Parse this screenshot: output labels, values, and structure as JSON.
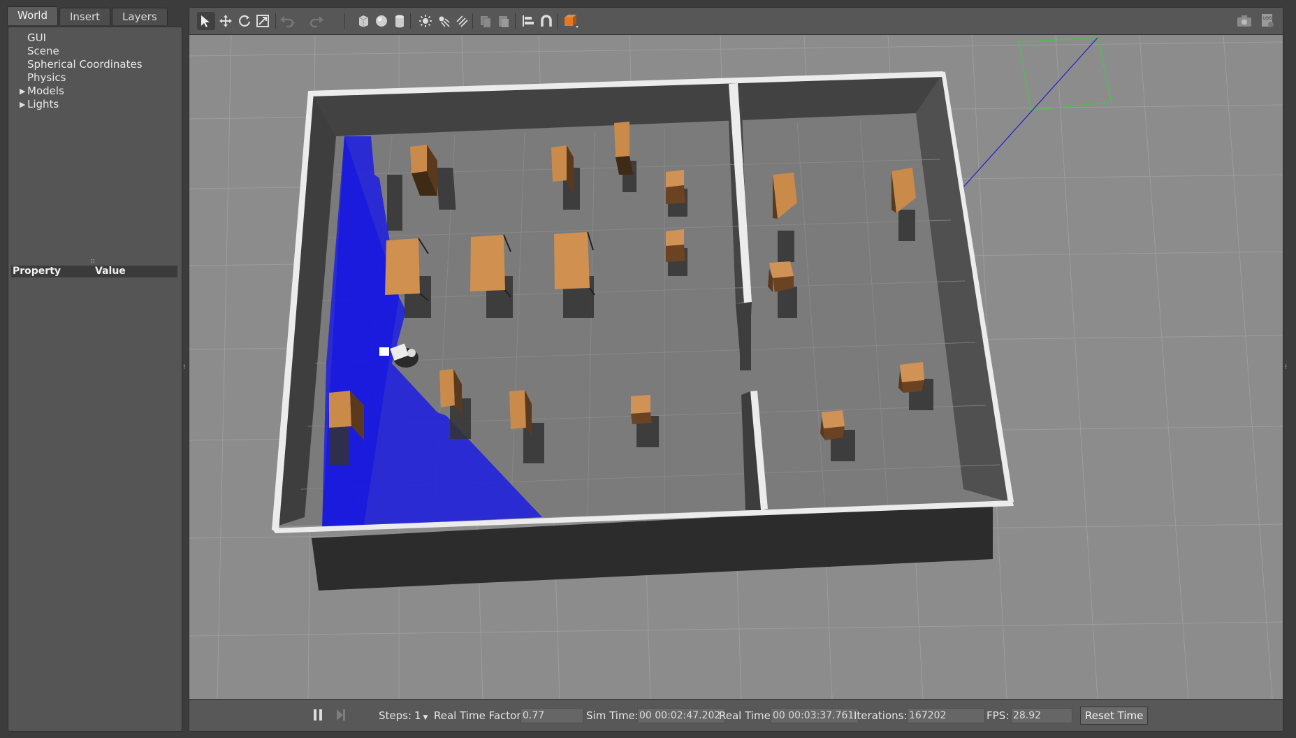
{
  "tabs": [
    "World",
    "Insert",
    "Layers"
  ],
  "world_tree": [
    {
      "label": "GUI",
      "expandable": false
    },
    {
      "label": "Scene",
      "expandable": false
    },
    {
      "label": "Spherical Coordinates",
      "expandable": false
    },
    {
      "label": "Physics",
      "expandable": false
    },
    {
      "label": "Models",
      "expandable": true
    },
    {
      "label": "Lights",
      "expandable": true
    }
  ],
  "property_table": {
    "col_property": "Property",
    "col_value": "Value"
  },
  "toolbar": {
    "tools": [
      "select-arrow-icon",
      "translate-icon",
      "rotate-icon",
      "scale-icon",
      "undo-icon",
      "redo-icon",
      "box-shape-icon",
      "sphere-shape-icon",
      "cylinder-shape-icon",
      "point-light-icon",
      "spot-light-icon",
      "directional-light-icon",
      "copy-icon",
      "paste-icon",
      "align-icon",
      "snap-magnet-icon",
      "view-angle-icon",
      "screenshot-camera-icon",
      "log-icon"
    ],
    "accent_color": "#e8781e"
  },
  "bottom_bar": {
    "steps_label": "Steps:",
    "steps_value": "1",
    "rtf_label": "Real Time Factor:",
    "rtf_value": "0.77",
    "sim_time_label": "Sim Time:",
    "sim_time_value": "00 00:02:47.202",
    "real_time_label": "Real Time:",
    "real_time_value": "00 00:03:37.761",
    "iterations_label": "Iterations:",
    "iterations_value": "167202",
    "fps_label": "FPS:",
    "fps_value": "28.92",
    "reset_label": "Reset Time"
  },
  "scene": {
    "background_color": "#8c8c8c",
    "wall_color": "#ececec",
    "floor_color": "#808080",
    "laser_color": "#1a1ae6",
    "box_color": "#c98a4a"
  }
}
